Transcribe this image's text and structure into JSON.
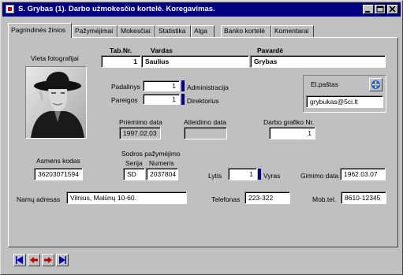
{
  "window": {
    "title": "S. Grybas  (1).  Darbo užmokesčio kortelė. Koregavimas."
  },
  "tabs": [
    {
      "label": "Pagrindinės žinios"
    },
    {
      "label": "Pažymėjimai"
    },
    {
      "label": "Mokesčiai"
    },
    {
      "label": "Statistika"
    },
    {
      "label": "Alga"
    },
    {
      "label": "Banko kortelė"
    },
    {
      "label": "Komentarai"
    }
  ],
  "photo": {
    "label": "Vieta fotografijai"
  },
  "employee": {
    "tabnr_label": "Tab.Nr.",
    "tabnr_value": "1",
    "firstname_label": "Vardas",
    "firstname_value": "Saulius",
    "lastname_label": "Pavardė",
    "lastname_value": "Grybas"
  },
  "department": {
    "label": "Padalinys",
    "code": "1",
    "name": "Administracija"
  },
  "position": {
    "label": "Pareigos",
    "code": "1",
    "name": "Direktorius"
  },
  "email": {
    "label": "El.paštas",
    "value": "grybukas@5ci.lt"
  },
  "employment": {
    "hire_label": "Priėmimo data",
    "hire_value": "1997.02.03",
    "dismiss_label": "Atleidimo data",
    "dismiss_value": "",
    "schedule_label": "Darbo grafiko Nr.",
    "schedule_value": "1"
  },
  "personal": {
    "code_label": "Asmens kodas",
    "code_value": "36203071594",
    "sodra_label": "Sodros pažymėjimo",
    "series_label": "Serija",
    "series_value": "SD",
    "number_label": "Numeris",
    "number_value": "2037804",
    "gender_label": "Lytis",
    "gender_code": "1",
    "gender_name": "Vyras",
    "birth_label": "Gimimo data",
    "birth_value": "1962.03.07"
  },
  "contact": {
    "address_label": "Namų adresas",
    "address_value": "Vilnius, Malūnų 10-60.",
    "phone_label": "Telefonas",
    "phone_value": "223-322",
    "mobile_label": "Mob.tel.",
    "mobile_value": "8610-12345"
  },
  "navigation": [
    {
      "icon": "first-record-icon"
    },
    {
      "icon": "previous-record-icon"
    },
    {
      "icon": "next-record-icon"
    },
    {
      "icon": "last-record-icon"
    }
  ],
  "colors": {
    "titlebar": "#000080",
    "nav_arrow_blue": "#0000c0",
    "nav_arrow_red": "#c00000"
  }
}
